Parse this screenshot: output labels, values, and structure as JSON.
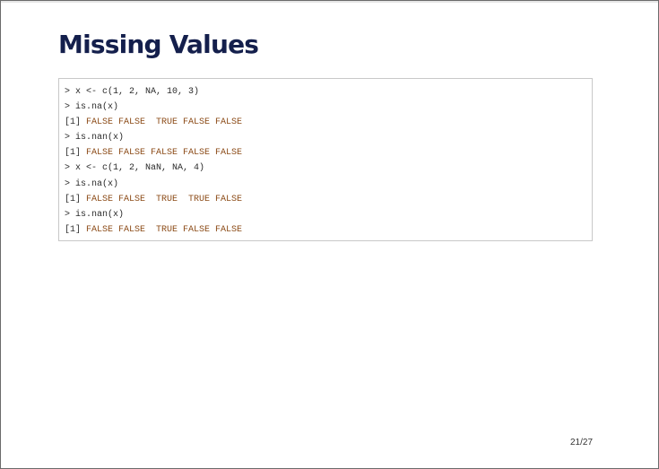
{
  "slide": {
    "title": "Missing Values",
    "code_lines": [
      {
        "type": "input",
        "prompt": ">",
        "text": "x <- c(1, 2, NA, 10, 3)"
      },
      {
        "type": "input",
        "prompt": ">",
        "text": "is.na(x)"
      },
      {
        "type": "output",
        "index": "[1]",
        "text": "FALSE FALSE  TRUE FALSE FALSE"
      },
      {
        "type": "input",
        "prompt": ">",
        "text": "is.nan(x)"
      },
      {
        "type": "output",
        "index": "[1]",
        "text": "FALSE FALSE FALSE FALSE FALSE"
      },
      {
        "type": "input",
        "prompt": ">",
        "text": "x <- c(1, 2, NaN, NA, 4)"
      },
      {
        "type": "input",
        "prompt": ">",
        "text": "is.na(x)"
      },
      {
        "type": "output",
        "index": "[1]",
        "text": "FALSE FALSE  TRUE  TRUE FALSE"
      },
      {
        "type": "input",
        "prompt": ">",
        "text": "is.nan(x)"
      },
      {
        "type": "output",
        "index": "[1]",
        "text": "FALSE FALSE  TRUE FALSE FALSE"
      }
    ],
    "page_number": "21/27"
  },
  "colors": {
    "title": "#141f4c",
    "output_value": "#8b4a16",
    "code_text": "#2a2a2a",
    "code_border": "#c8c8c8"
  }
}
